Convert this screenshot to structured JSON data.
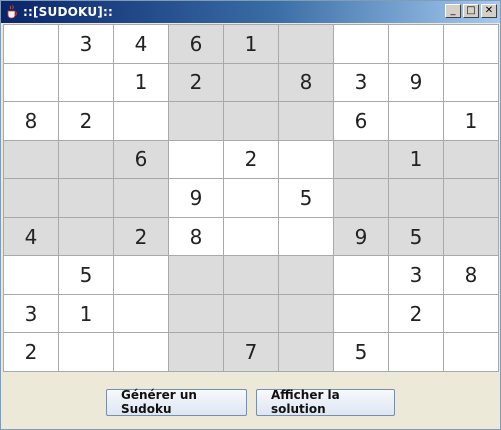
{
  "window": {
    "title": "::[SUDOKU]::",
    "controls": {
      "minimize": "_",
      "maximize": "□",
      "close": "✕"
    }
  },
  "grid": {
    "rows": [
      [
        "",
        "3",
        "4",
        "6",
        "1",
        "",
        "",
        "",
        ""
      ],
      [
        "",
        "",
        "1",
        "2",
        "",
        "8",
        "3",
        "9",
        ""
      ],
      [
        "8",
        "2",
        "",
        "",
        "",
        "",
        "6",
        "",
        "1"
      ],
      [
        "",
        "",
        "6",
        "",
        "2",
        "",
        "",
        "1",
        ""
      ],
      [
        "",
        "",
        "",
        "9",
        "",
        "5",
        "",
        "",
        ""
      ],
      [
        "4",
        "",
        "2",
        "8",
        "",
        "",
        "9",
        "5",
        ""
      ],
      [
        "",
        "5",
        "",
        "",
        "",
        "",
        "",
        "3",
        "8"
      ],
      [
        "3",
        "1",
        "",
        "",
        "",
        "",
        "",
        "2",
        ""
      ],
      [
        "2",
        "",
        "",
        "",
        "7",
        "",
        "5",
        "",
        ""
      ]
    ],
    "colors": {
      "light": "#ffffff",
      "shaded": "#dcdcdc"
    }
  },
  "buttons": {
    "generate": "Générer un Sudoku",
    "solution": "Afficher la solution"
  }
}
